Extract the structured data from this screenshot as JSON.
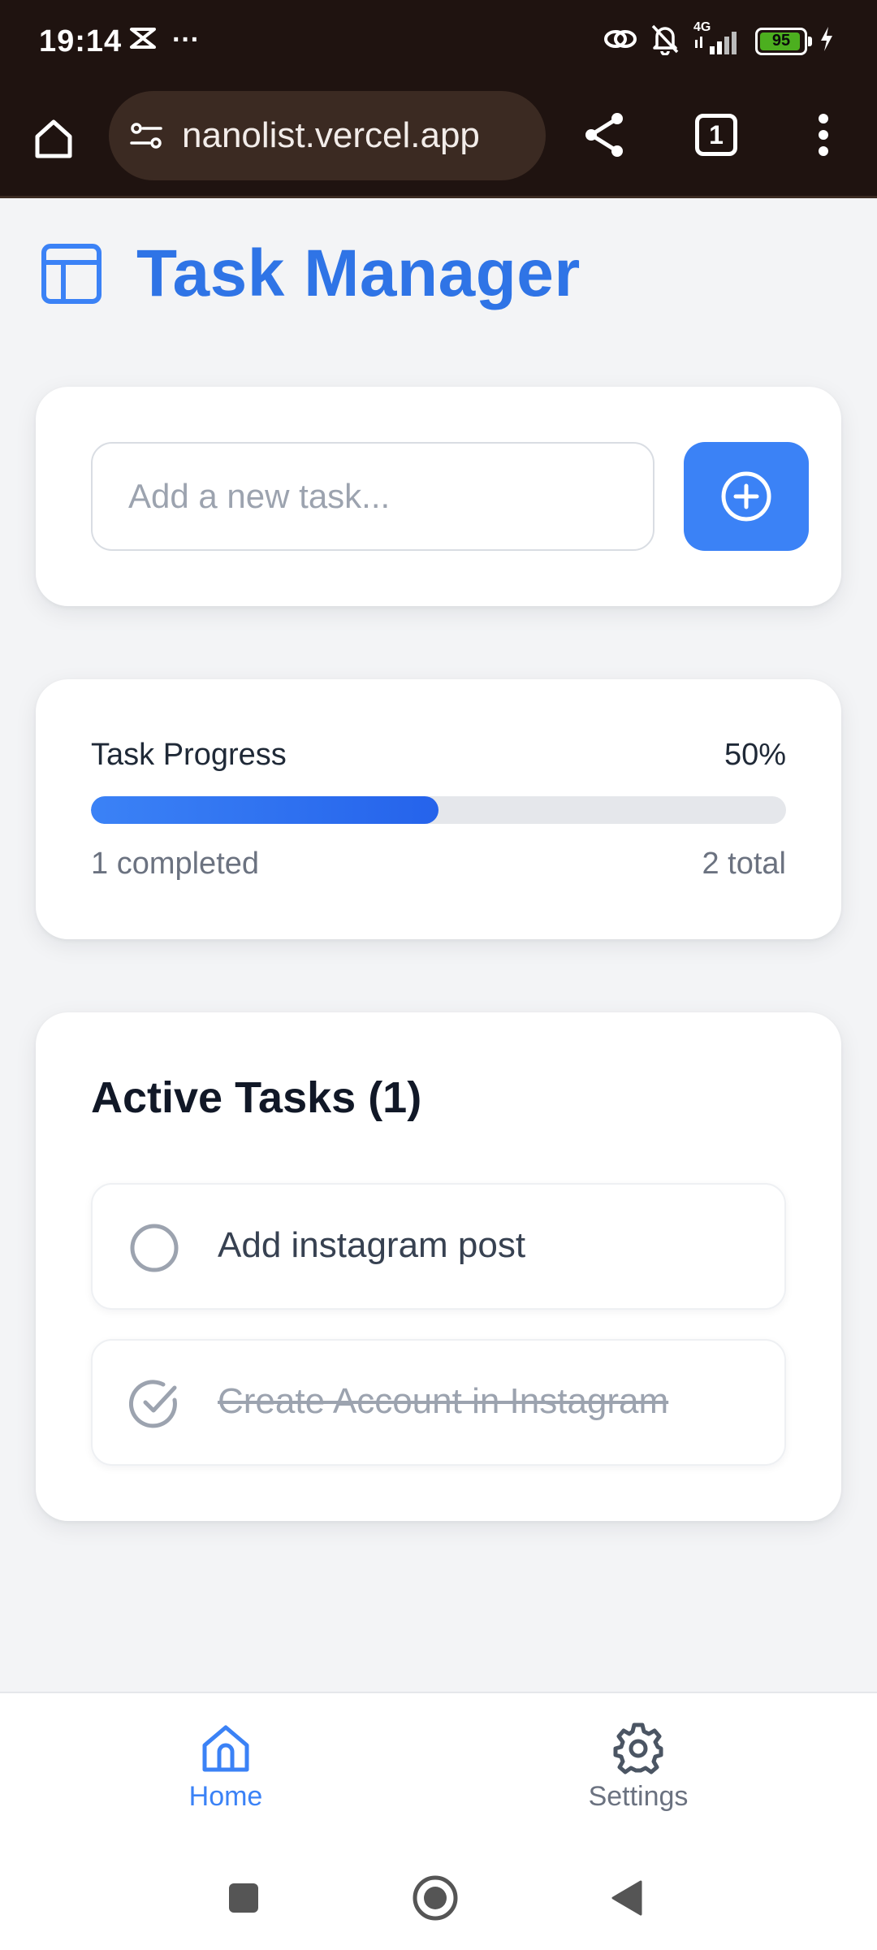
{
  "status_bar": {
    "time": "19:14",
    "overflow": "···",
    "network": "4G",
    "battery": "95",
    "battery_level": 0.95,
    "icons": [
      "notification-app-icon",
      "link-icon",
      "bell-off-icon",
      "signal-icon",
      "battery-icon",
      "charging-bolt-icon"
    ]
  },
  "browser": {
    "url": "nanolist.vercel.app",
    "tab_count": "1",
    "icons": [
      "home-icon",
      "site-settings-icon",
      "share-icon",
      "tabs-icon",
      "more-vert-icon"
    ]
  },
  "app": {
    "title": "Task Manager",
    "title_icon": "layout-icon",
    "accent_color": "#3b82f6"
  },
  "add_task": {
    "placeholder": "Add a new task...",
    "value": "",
    "button_icon": "plus-circle-icon"
  },
  "progress": {
    "label": "Task Progress",
    "percent_text": "50%",
    "percent": 50,
    "completed_text": "1 completed",
    "total_text": "2 total"
  },
  "tasks": {
    "heading": "Active Tasks (1)",
    "items": [
      {
        "text": "Add instagram post",
        "completed": false
      },
      {
        "text": "Create Account in Instagram",
        "completed": true
      }
    ]
  },
  "bottom_nav": {
    "items": [
      {
        "label": "Home",
        "icon": "home-icon",
        "active": true
      },
      {
        "label": "Settings",
        "icon": "gear-icon",
        "active": false
      }
    ]
  },
  "system_nav": {
    "icons": [
      "recents-icon",
      "home-circle-icon",
      "back-icon"
    ]
  }
}
